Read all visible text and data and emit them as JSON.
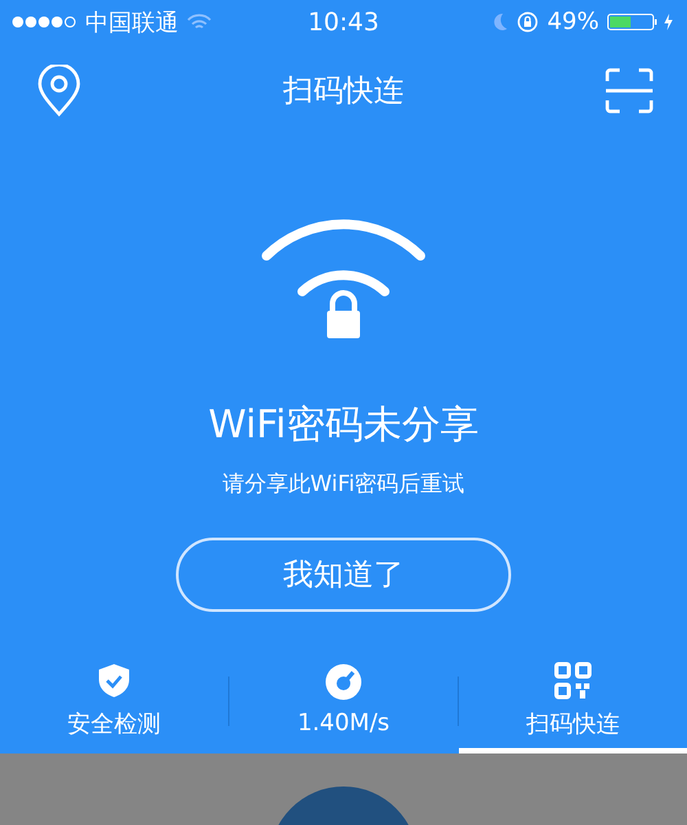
{
  "status_bar": {
    "carrier": "中国联通",
    "time": "10:43",
    "battery": "49%"
  },
  "header": {
    "title": "扫码快连"
  },
  "message": {
    "title": "WiFi密码未分享",
    "subtitle": "请分享此WiFi密码后重试",
    "button": "我知道了"
  },
  "tabs": [
    {
      "kind": "shield",
      "label": "安全检测",
      "selected": false
    },
    {
      "kind": "speed",
      "label": "1.40M/s",
      "selected": false
    },
    {
      "kind": "qr",
      "label": "扫码快连",
      "selected": true
    }
  ]
}
